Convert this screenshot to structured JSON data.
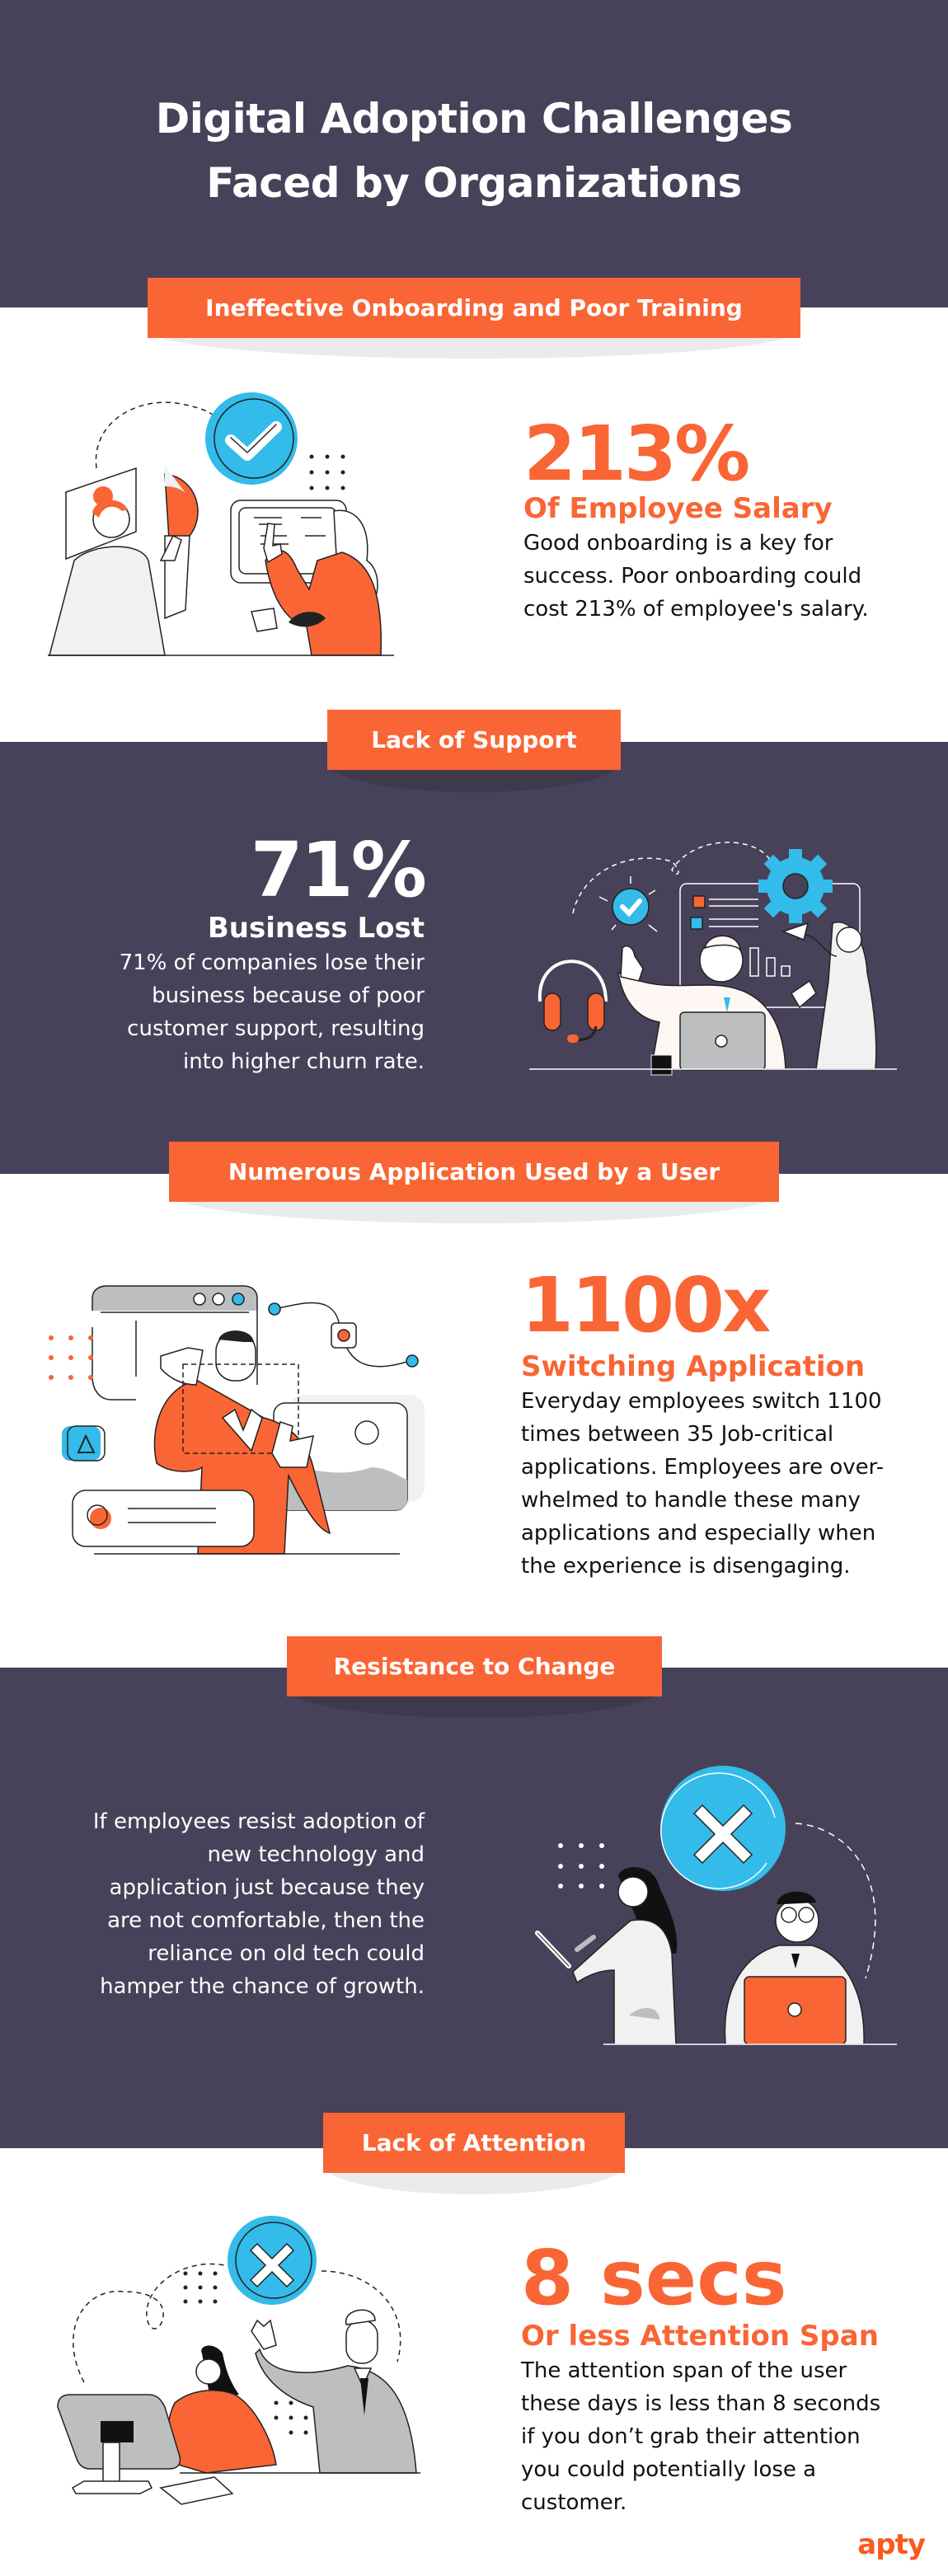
{
  "header": {
    "title_line1": "Digital Adoption Challenges",
    "title_line2": "Faced by Organizations"
  },
  "colors": {
    "dark_bg": "#474259",
    "accent_orange": "#f96534",
    "accent_blue": "#33bbea",
    "light_gray": "#f0f1f1",
    "mid_gray": "#bdbec0"
  },
  "sections": [
    {
      "tag": "Ineffective Onboarding and Poor Training",
      "stat": "213%",
      "subtitle": "Of Employee Salary",
      "description": "Good onboarding is a key for success. Poor onboarding could cost 213% of employee's salary.",
      "illustration": "onboarding-training-illustration",
      "icon": "checkmark-circle-icon"
    },
    {
      "tag": "Lack of Support",
      "stat": "71%",
      "subtitle": "Business Lost",
      "description": "71% of companies lose their business because of poor customer support, resulting into higher churn rate.",
      "illustration": "customer-support-illustration",
      "icon": "headset-icon"
    },
    {
      "tag": "Numerous Application Used by a User",
      "stat": "1100x",
      "subtitle": "Switching Application",
      "description": "Everyday employees switch 1100 times between 35 Job-critical applications. Employees are over-whelmed to handle these many applications and especially when the experience is disengaging.",
      "illustration": "app-switching-illustration",
      "icon": "browser-window-icon"
    },
    {
      "tag": "Resistance to Change",
      "description": "If employees resist adoption of new technology and application just because they are not comfortable, then the reliance on old tech could hamper the chance of growth.",
      "illustration": "resistance-to-change-illustration",
      "icon": "x-circle-icon"
    },
    {
      "tag": "Lack of Attention",
      "stat": "8 secs",
      "subtitle": "Or less Attention Span",
      "description": "The attention span of the user these days is less than 8 seconds if you don’t grab their attention you could potentially lose a customer.",
      "illustration": "lack-of-attention-illustration",
      "icon": "x-circle-icon"
    }
  ],
  "footer": {
    "logo": "apty"
  }
}
